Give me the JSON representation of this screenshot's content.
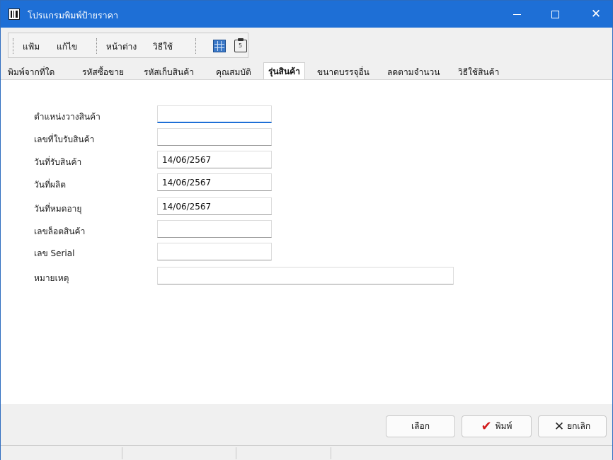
{
  "window": {
    "title": "โปรแกรมพิมพ์ป้ายราคา",
    "controls": {
      "close": "✕"
    }
  },
  "menu": {
    "items": [
      "แฟ้ม",
      "แก้ไข",
      "หน้าต่าง",
      "วิธีใช้"
    ],
    "toolbar_icons": [
      "table-icon",
      "clipboard-icon"
    ],
    "clipboard_glyph": "5"
  },
  "tabs": {
    "items": [
      "พิมพ์จากที่ใด",
      "รหัสซื้อขาย",
      "รหัสเก็บสินค้า",
      "คุณสมบัติ",
      "รุ่นสินค้า",
      "ขนาดบรรจุอื่น",
      "ลดตามจำนวน",
      "วิธีใช้สินค้า"
    ],
    "active": "รุ่นสินค้า"
  },
  "form": {
    "fields": [
      {
        "label": "ตำแหน่งวางสินค้า",
        "value": ""
      },
      {
        "label": "เลขที่ใบรับสินค้า",
        "value": ""
      },
      {
        "label": "วันที่รับสินค้า",
        "value": "14/06/2567"
      },
      {
        "label": "วันที่ผลิต",
        "value": "14/06/2567"
      },
      {
        "label": "วันที่หมดอายุ",
        "value": "14/06/2567"
      },
      {
        "label": "เลขล็อตสินค้า",
        "value": ""
      },
      {
        "label": "เลข Serial",
        "value": ""
      },
      {
        "label": "หมายเหตุ",
        "value": ""
      }
    ]
  },
  "buttons": {
    "select": "เลือก",
    "print": "พิมพ์",
    "cancel": "ยกเลิก",
    "print_icon": "✔",
    "cancel_icon": "✕"
  },
  "colors": {
    "titlebar": "#1e6fd6",
    "print_check": "#d11a1a"
  }
}
